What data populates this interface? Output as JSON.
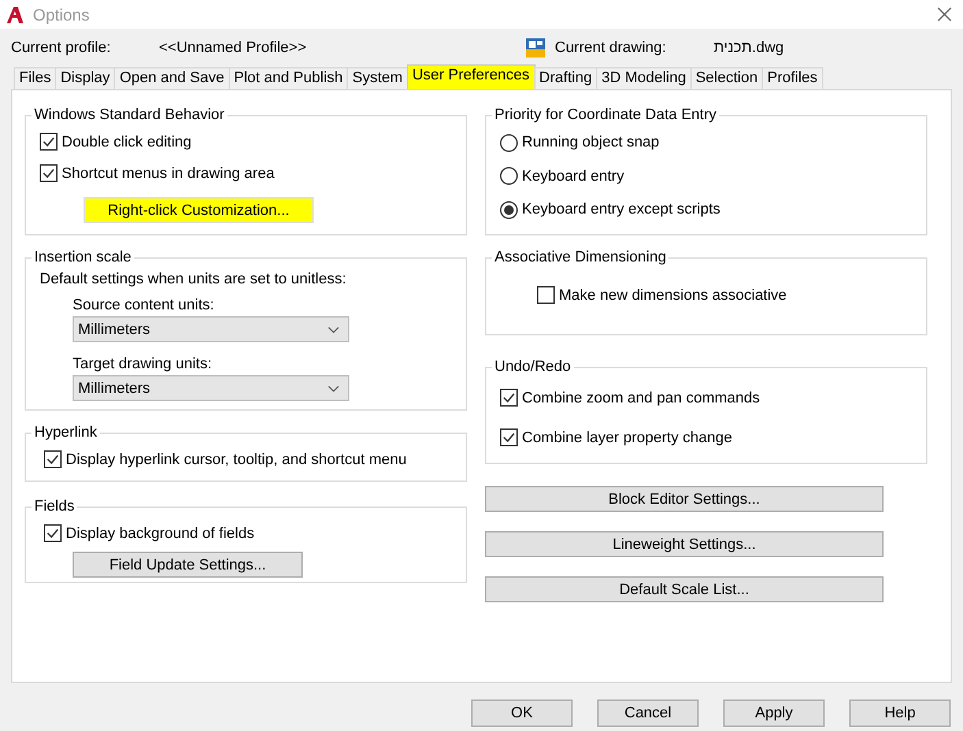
{
  "window": {
    "title": "Options"
  },
  "profile": {
    "label": "Current profile:",
    "value": "<<Unnamed Profile>>"
  },
  "drawing": {
    "label": "Current drawing:",
    "value": "תכנית.dwg"
  },
  "tabs": [
    {
      "label": "Files",
      "selected": false
    },
    {
      "label": "Display",
      "selected": false
    },
    {
      "label": "Open and Save",
      "selected": false
    },
    {
      "label": "Plot and Publish",
      "selected": false
    },
    {
      "label": "System",
      "selected": false
    },
    {
      "label": "User Preferences",
      "selected": true
    },
    {
      "label": "Drafting",
      "selected": false
    },
    {
      "label": "3D Modeling",
      "selected": false
    },
    {
      "label": "Selection",
      "selected": false
    },
    {
      "label": "Profiles",
      "selected": false
    }
  ],
  "columns": [
    {
      "groups": [
        {
          "title": "Windows Standard Behavior",
          "items": [
            {
              "kind": "checkbox",
              "label": "Double click editing",
              "checked": true
            },
            {
              "kind": "checkbox",
              "label": "Shortcut menus in drawing area",
              "checked": true
            },
            {
              "kind": "button",
              "label": "Right-click Customization...",
              "highlighted": true
            }
          ]
        },
        {
          "title": "Insertion scale",
          "items": [
            {
              "kind": "text",
              "label": "Default settings when units are set to unitless:"
            },
            {
              "kind": "select",
              "label": "Source content units:",
              "value": "Millimeters"
            },
            {
              "kind": "select",
              "label": "Target drawing units:",
              "value": "Millimeters"
            }
          ]
        },
        {
          "title": "Hyperlink",
          "items": [
            {
              "kind": "checkbox",
              "label": "Display hyperlink cursor, tooltip, and shortcut menu",
              "checked": true
            }
          ]
        },
        {
          "title": "Fields",
          "items": [
            {
              "kind": "checkbox",
              "label": "Display background of fields",
              "checked": true
            },
            {
              "kind": "button",
              "label": "Field Update Settings...",
              "highlighted": false
            }
          ]
        }
      ]
    },
    {
      "groups": [
        {
          "title": "Priority for Coordinate Data Entry",
          "items": [
            {
              "kind": "radio",
              "label": "Running object snap",
              "selected": false
            },
            {
              "kind": "radio",
              "label": "Keyboard entry",
              "selected": false
            },
            {
              "kind": "radio",
              "label": "Keyboard entry except scripts",
              "selected": true
            }
          ]
        },
        {
          "title": "Associative Dimensioning",
          "items": [
            {
              "kind": "checkbox",
              "label": "Make new dimensions associative",
              "checked": false
            }
          ]
        },
        {
          "title": "Undo/Redo",
          "items": [
            {
              "kind": "checkbox",
              "label": "Combine zoom and pan commands",
              "checked": true
            },
            {
              "kind": "checkbox",
              "label": "Combine layer property change",
              "checked": true
            }
          ]
        }
      ],
      "buttons": [
        "Block Editor Settings...",
        "Lineweight Settings...",
        "Default Scale List..."
      ]
    }
  ],
  "footer_buttons": [
    "OK",
    "Cancel",
    "Apply",
    "Help"
  ]
}
